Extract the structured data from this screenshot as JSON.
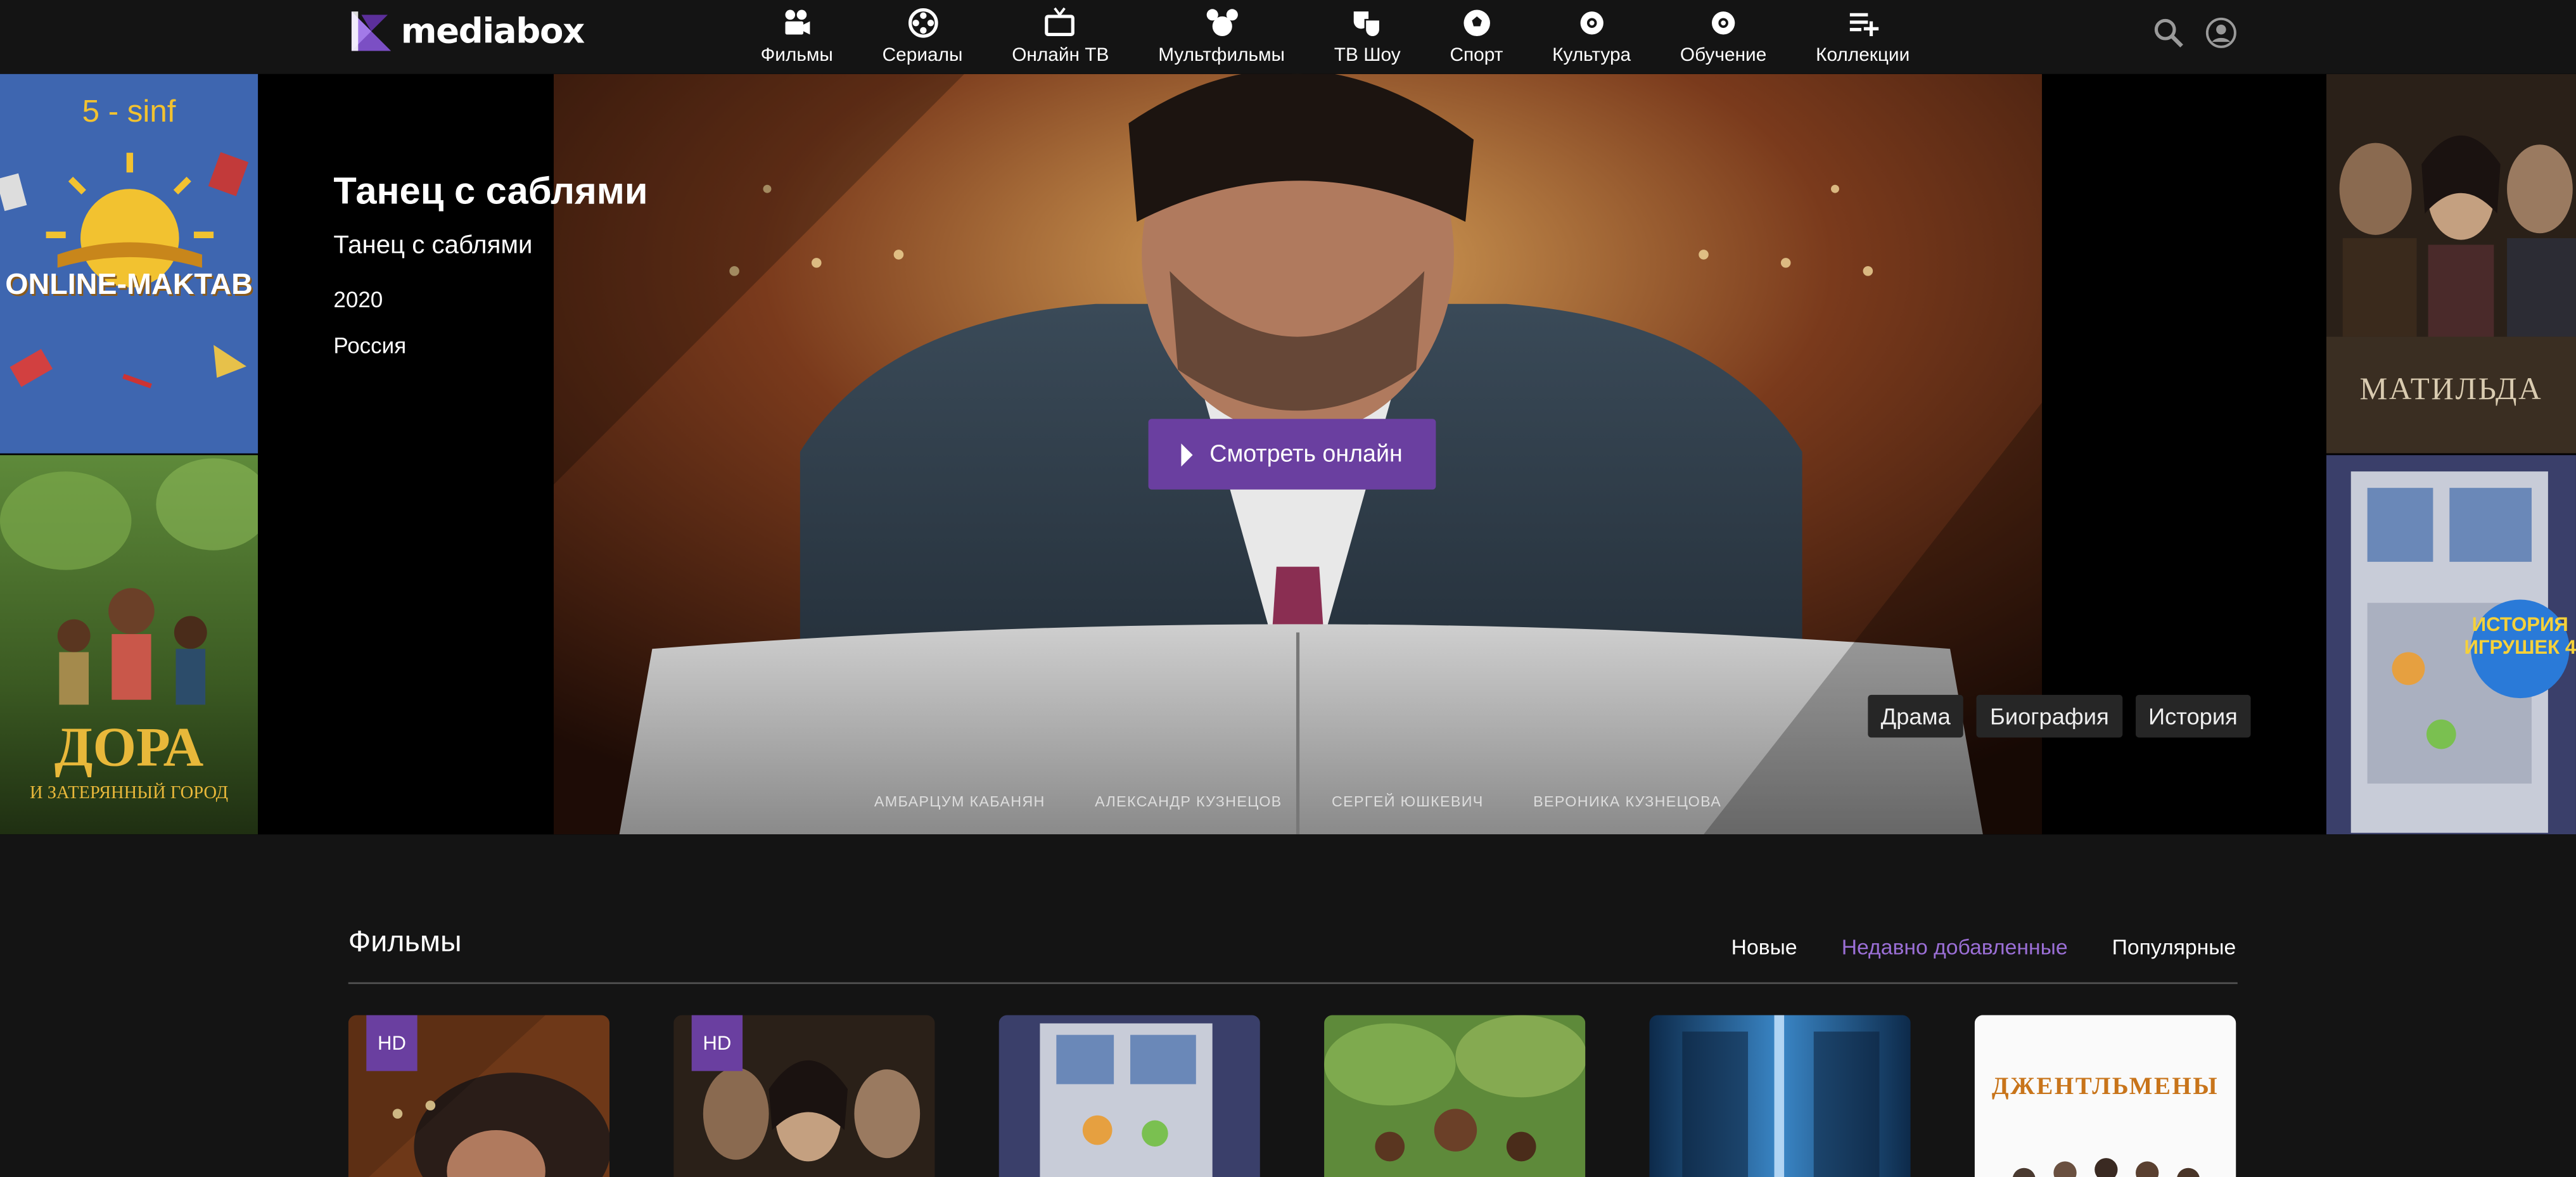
{
  "app": {
    "brand": "mediabox"
  },
  "nav": [
    {
      "label": "Фильмы",
      "icon": "film-camera-icon"
    },
    {
      "label": "Сериалы",
      "icon": "film-reel-icon"
    },
    {
      "label": "Онлайн ТВ",
      "icon": "tv-icon"
    },
    {
      "label": "Мультфильмы",
      "icon": "mickey-icon"
    },
    {
      "label": "ТВ Шоу",
      "icon": "theater-masks-icon"
    },
    {
      "label": "Спорт",
      "icon": "soccer-ball-icon"
    },
    {
      "label": "Культура",
      "icon": "culture-icon"
    },
    {
      "label": "Обучение",
      "icon": "education-icon"
    },
    {
      "label": "Коллекции",
      "icon": "playlist-add-icon"
    }
  ],
  "hero": {
    "title": "Танец с саблями",
    "subtitle": "Танец с саблями",
    "year": "2020",
    "country": "Россия",
    "watch_label": "Смотреть онлайн",
    "genres": [
      "Драма",
      "Биография",
      "История"
    ],
    "left_tiles": [
      {
        "top_text": "5 - sinf",
        "main_text": "ONLINE-MAKTAB"
      },
      {
        "main_text": "ДОРА",
        "sub_text": "И ЗАТЕРЯННЫЙ ГОРОД"
      }
    ],
    "right_tiles": [
      {
        "main_text": "МАТИЛЬДА"
      },
      {
        "main_text": "ИСТОРИЯ ИГРУШЕК 4"
      }
    ],
    "poster_credits": [
      "АМБАРЦУМ КАБАНЯН",
      "АЛЕКСАНДР КУЗНЕЦОВ",
      "СЕРГЕЙ ЮШКЕВИЧ",
      "ВЕРОНИКА КУЗНЕЦОВА"
    ]
  },
  "films": {
    "title": "Фильмы",
    "filters": [
      {
        "label": "Новые",
        "active": false
      },
      {
        "label": "Недавно добавленные",
        "active": true
      },
      {
        "label": "Популярные",
        "active": false
      }
    ],
    "cards": [
      {
        "hd": "HD",
        "theme": "dance"
      },
      {
        "hd": "HD",
        "theme": "matilda"
      },
      {
        "hd": "",
        "theme": "toystory"
      },
      {
        "hd": "",
        "theme": "dora"
      },
      {
        "hd": "",
        "theme": "blue"
      },
      {
        "hd": "",
        "theme": "gentlemen",
        "title": "ДЖЕНТЛЬМЕНЫ"
      }
    ]
  },
  "colors": {
    "accent": "#6a3fa0",
    "active_filter": "#9b6fd6",
    "background": "#141414"
  }
}
